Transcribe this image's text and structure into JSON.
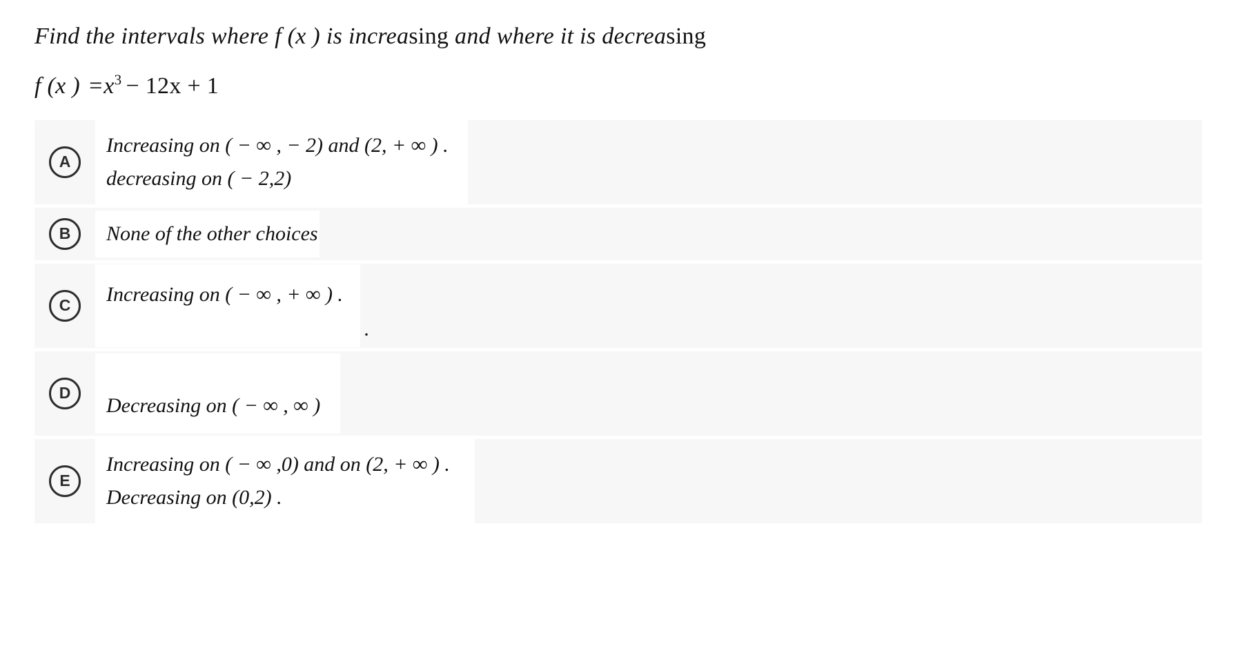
{
  "question": {
    "prompt_parts": [
      {
        "text": "Find the intervals where ",
        "style": "italic"
      },
      {
        "text": "f (x )",
        "style": "italic"
      },
      {
        "text": " is increa",
        "style": "italic"
      },
      {
        "text": "sing",
        "style": "upright"
      },
      {
        "text": " and  where it is decrea",
        "style": "italic"
      },
      {
        "text": "sing",
        "style": "upright"
      }
    ],
    "prompt_text": "Find the intervals where f (x ) is increasing and  where it is decreasing",
    "formula_text": "f (x ) = x 3 − 12x + 1",
    "formula": {
      "fx": "f (x )",
      "equals": "=",
      "base": "x",
      "exponent": "3",
      "rest": "− 12x + 1"
    }
  },
  "options": [
    {
      "letter": "A",
      "lines": [
        "Increasing on ( − ∞ , − 2) and (2, + ∞ ) .",
        "decreasing on ( − 2,2)"
      ],
      "blank_lines_before": 0,
      "trailing_dot_outside": false
    },
    {
      "letter": "B",
      "lines": [
        "None of  the other choices"
      ],
      "blank_lines_before": 0,
      "trailing_dot_outside": false
    },
    {
      "letter": "C",
      "lines": [
        "Increasing on ( − ∞ , + ∞ ) ."
      ],
      "blank_lines_before": 0,
      "trailing_dot_outside": true,
      "stray_dot": "."
    },
    {
      "letter": "D",
      "lines": [
        "Decreasing on ( − ∞ , ∞ )"
      ],
      "blank_lines_before": 1,
      "trailing_dot_outside": false
    },
    {
      "letter": "E",
      "lines": [
        "Increasing on ( − ∞ ,0) and on (2, + ∞ ) .",
        "Decreasing on (0,2) ."
      ],
      "blank_lines_before": 0,
      "trailing_dot_outside": false
    }
  ],
  "colors": {
    "page_background": "#ffffff",
    "row_background": "#f7f7f7",
    "answer_box_background": "#ffffff",
    "text": "#111111",
    "badge_stroke": "#2c2c2c"
  }
}
